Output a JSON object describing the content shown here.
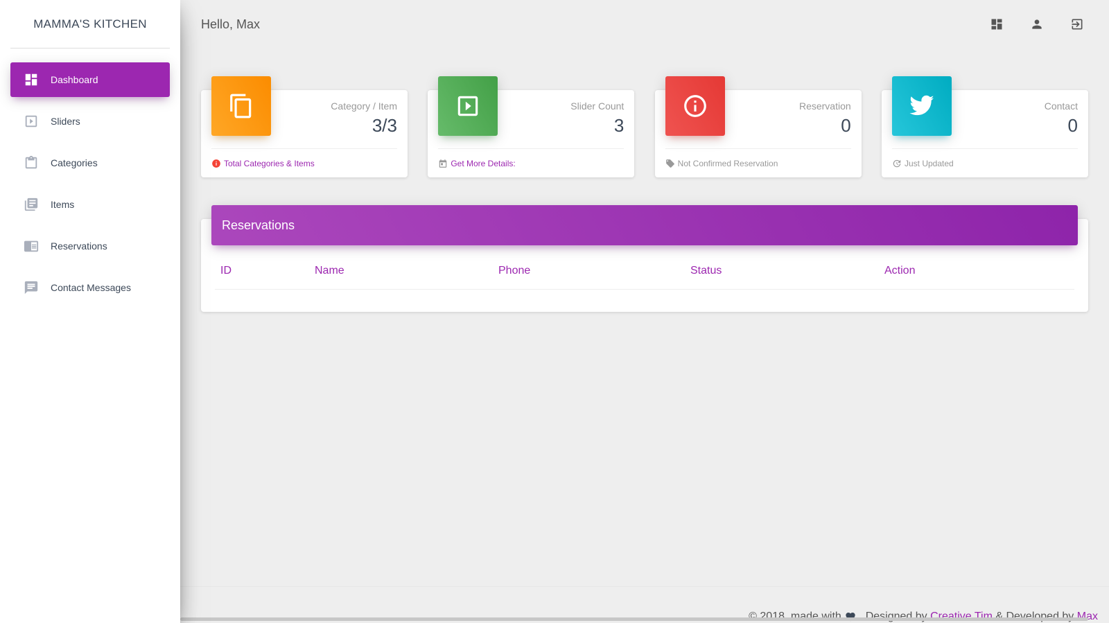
{
  "sidebar": {
    "brand": "MAMMA'S KITCHEN",
    "items": [
      {
        "label": "Dashboard",
        "icon": "dashboard-icon",
        "active": true
      },
      {
        "label": "Sliders",
        "icon": "slideshow-icon"
      },
      {
        "label": "Categories",
        "icon": "clipboard-icon"
      },
      {
        "label": "Items",
        "icon": "library-books-icon"
      },
      {
        "label": "Reservations",
        "icon": "chrome-reader-icon"
      },
      {
        "label": "Contact Messages",
        "icon": "chat-icon"
      }
    ]
  },
  "topbar": {
    "greeting": "Hello, Max",
    "icons": [
      "dashboard-icon",
      "person-icon",
      "logout-icon"
    ]
  },
  "cards": [
    {
      "category": "Category / Item",
      "value": "3/3",
      "footer": "Total Categories & Items",
      "color": "#fb8c00",
      "icon": "content-copy-icon",
      "footer_icon": "info-icon"
    },
    {
      "category": "Slider Count",
      "value": "3",
      "footer": "Get More Details:",
      "color": "#43a047",
      "icon": "slideshow-icon",
      "footer_icon": "calendar-icon"
    },
    {
      "category": "Reservation",
      "value": "0",
      "footer": "Not Confirmed Reservation",
      "color": "#e53935",
      "icon": "info-outline-icon",
      "footer_icon": "tag-icon"
    },
    {
      "category": "Contact",
      "value": "0",
      "footer": "Just Updated",
      "color": "#00acc1",
      "icon": "twitter-icon",
      "footer_icon": "update-icon"
    }
  ],
  "reservations": {
    "title": "Reservations",
    "columns": [
      "ID",
      "Name",
      "Phone",
      "Status",
      "Action"
    ],
    "rows": []
  },
  "footer": {
    "prefix": "© 2018, made with",
    "designed_by_text": ", Designed by",
    "designer": "Creative Tim",
    "developed_by_text": "& Developed by",
    "developer": "Max"
  },
  "colors": {
    "accent": "#9c27b0",
    "background": "#eeeeee"
  }
}
